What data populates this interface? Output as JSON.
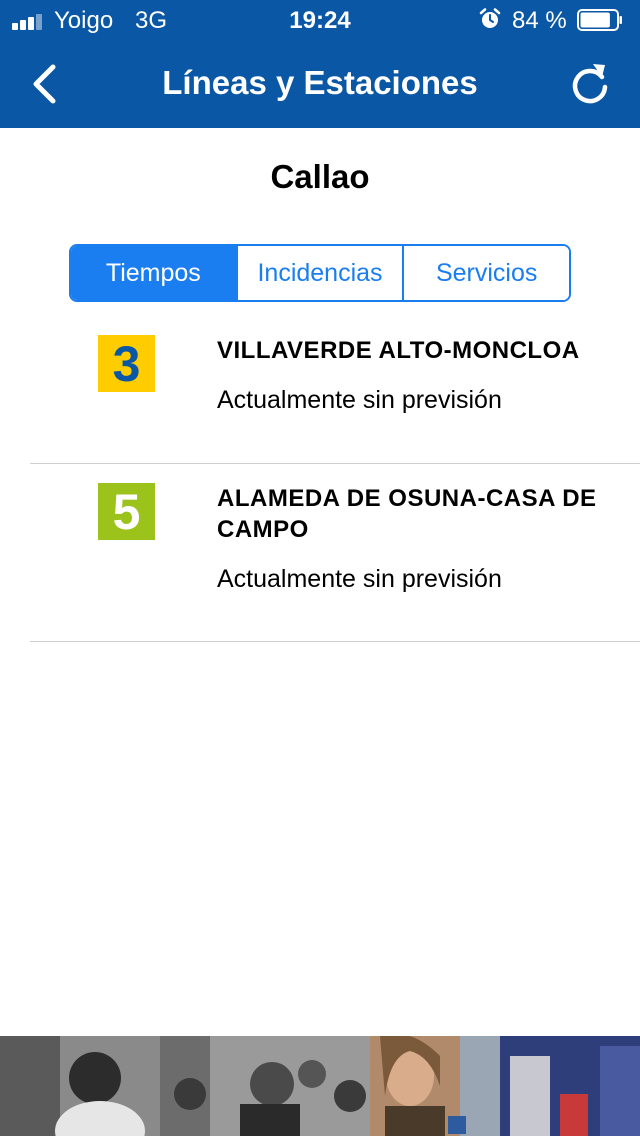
{
  "status_bar": {
    "carrier": "Yoigo",
    "network": "3G",
    "time": "19:24",
    "battery_percent": "84 %",
    "battery_level": 0.84,
    "icons": [
      "signal-icon",
      "alarm-icon",
      "battery-icon"
    ]
  },
  "nav": {
    "title": "Líneas y Estaciones",
    "back_icon": "chevron-left-icon",
    "refresh_icon": "refresh-icon"
  },
  "station": {
    "name": "Callao"
  },
  "tabs": [
    {
      "label": "Tiempos",
      "active": true
    },
    {
      "label": "Incidencias",
      "active": false
    },
    {
      "label": "Servicios",
      "active": false
    }
  ],
  "lines": [
    {
      "number": "3",
      "name": "VILLAVERDE ALTO-MONCLOA",
      "status": "Actualmente sin previsión",
      "badge_color": "#ffcc00",
      "number_color": "#0a57a5"
    },
    {
      "number": "5",
      "name": "ALAMEDA DE OSUNA-CASA DE CAMPO",
      "status": "Actualmente sin previsión",
      "badge_color": "#9bc31c",
      "number_color": "#ffffff"
    }
  ],
  "colors": {
    "brand_blue": "#0a57a5",
    "accent_blue": "#1a7ef0"
  }
}
